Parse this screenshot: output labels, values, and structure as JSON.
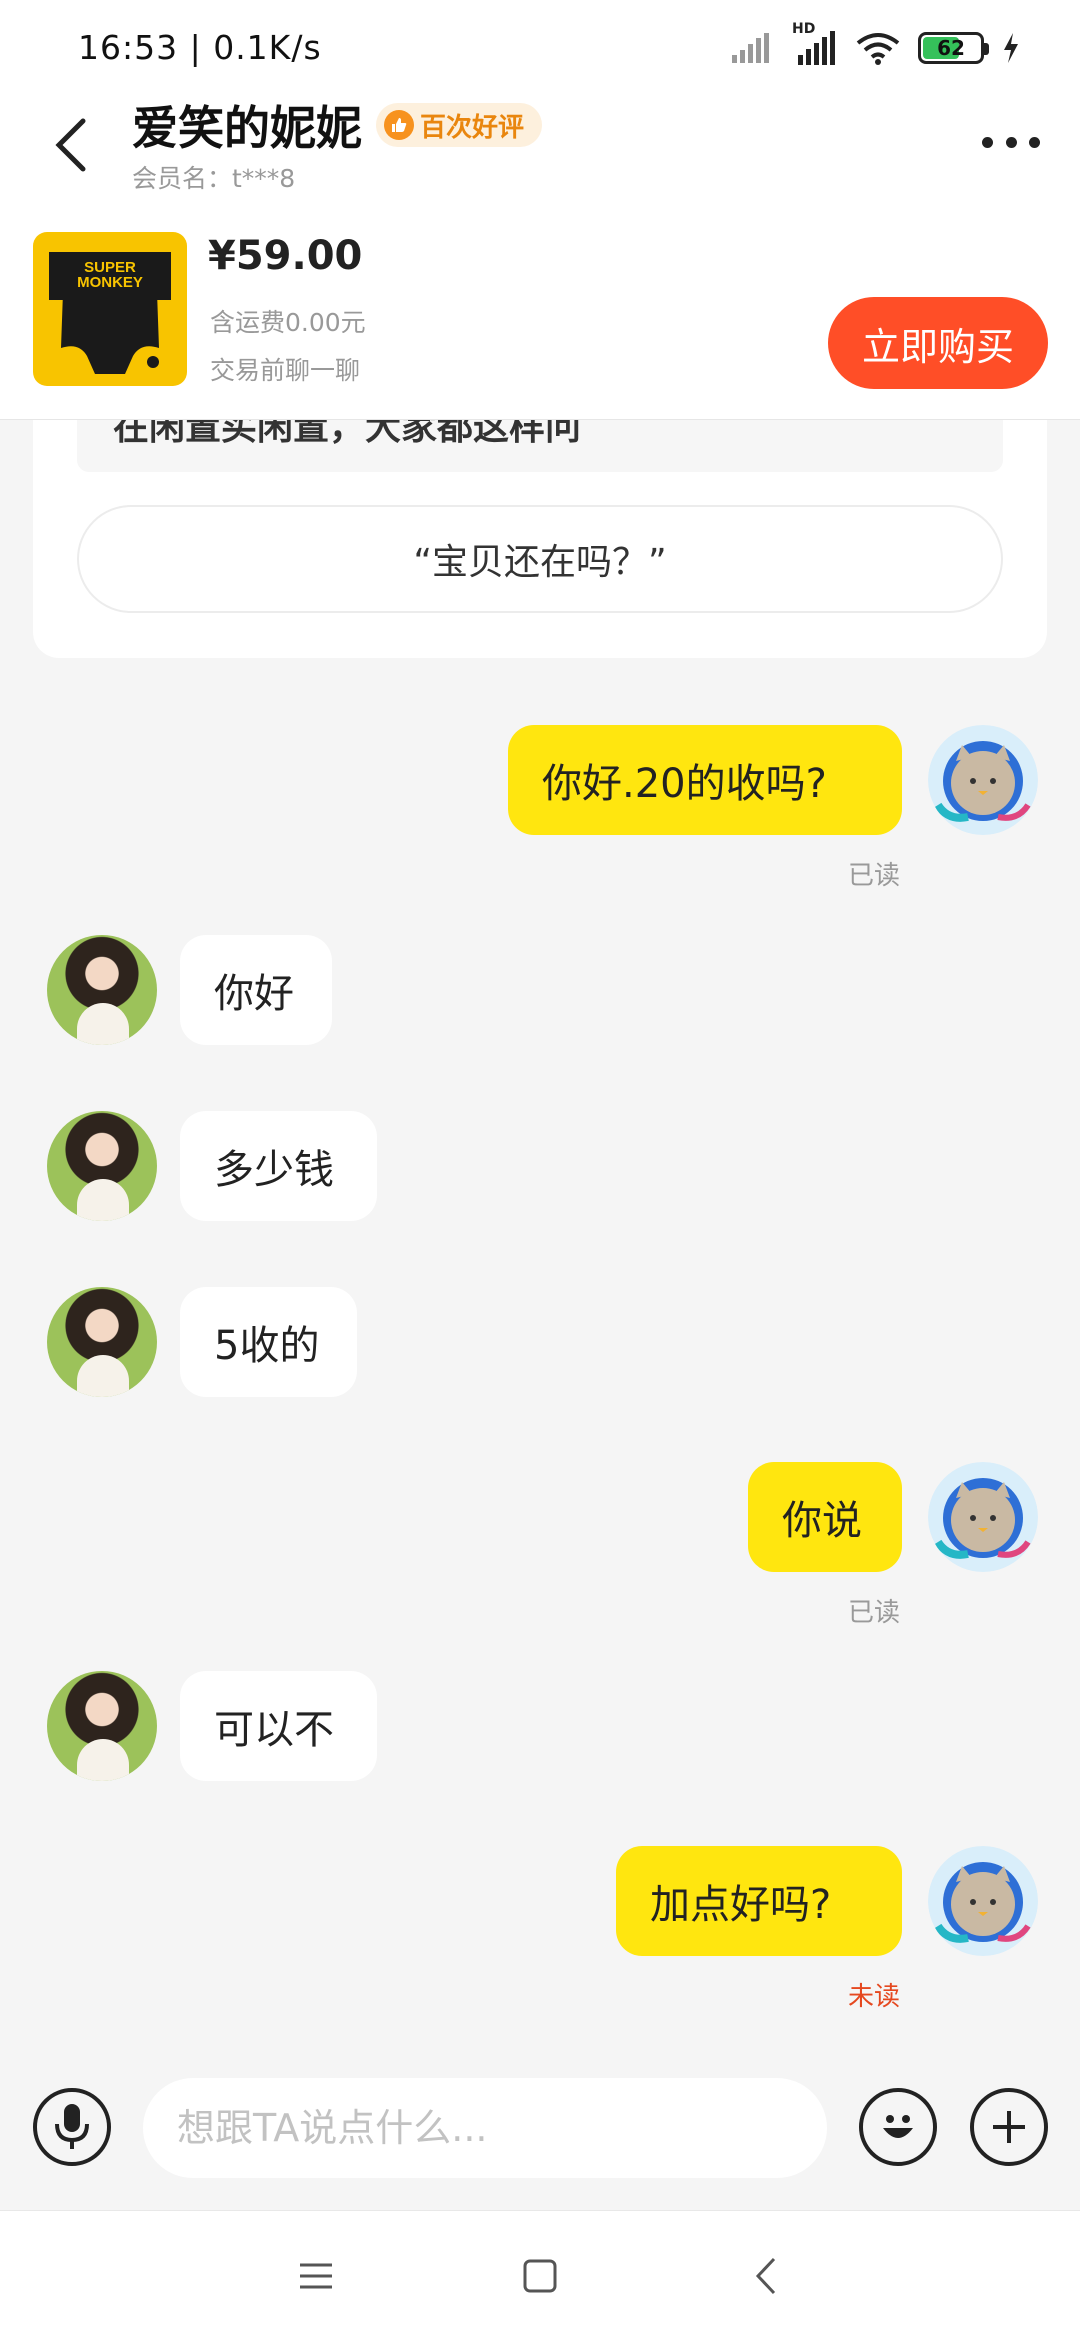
{
  "status_bar": {
    "time_speed": "16:53 | 0.1K/s",
    "battery": "62",
    "hd": "HD",
    "icons": [
      "signal-icon",
      "hd-signal-icon",
      "wifi-icon",
      "battery-icon",
      "charging-icon"
    ]
  },
  "header": {
    "seller_name": "爱笑的妮妮",
    "badge": "百次好评",
    "member_id": "会员名：t***8"
  },
  "product": {
    "thumb_text_line1": "SUPER",
    "thumb_text_line2": "MONKEY",
    "price": "¥59.00",
    "shipping": "含运费0.00元",
    "chat_first": "交易前聊一聊",
    "buy_label": "立即购买"
  },
  "card": {
    "partial_text": "在闲置买闲置，大家都这样问",
    "quick_question": "“宝贝还在吗？”"
  },
  "messages": [
    {
      "side": "mine",
      "text": "你好.20的收吗?",
      "status": "已读"
    },
    {
      "side": "theirs",
      "text": "你好"
    },
    {
      "side": "theirs",
      "text": "多少钱"
    },
    {
      "side": "theirs",
      "text": "5收的"
    },
    {
      "side": "mine",
      "text": "你说",
      "status": "已读"
    },
    {
      "side": "theirs",
      "text": "可以不"
    },
    {
      "side": "mine",
      "text": "加点好吗?",
      "status": "未读"
    }
  ],
  "input": {
    "placeholder": "想跟TA说点什么..."
  },
  "colors": {
    "accent_yellow": "#ffe60f",
    "buy_orange": "#ff4e27",
    "unread_red": "#e5481f",
    "badge_orange": "#e9860e"
  }
}
